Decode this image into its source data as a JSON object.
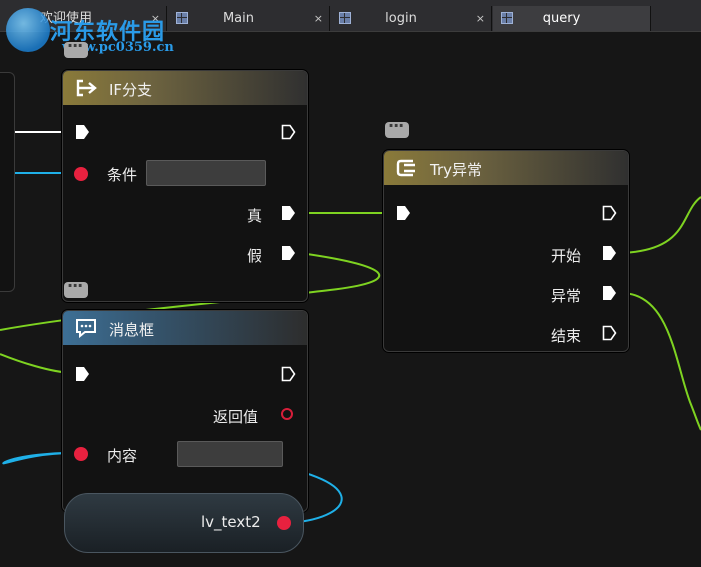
{
  "tabs": [
    {
      "label": "欢迎使用",
      "close": "×",
      "active": false
    },
    {
      "label": "Main",
      "close": "×",
      "active": false
    },
    {
      "label": "login",
      "close": "×",
      "active": false
    },
    {
      "label": "query",
      "close": "",
      "active": true
    }
  ],
  "watermark": {
    "text": "河东软件园",
    "url": "www.pc0359.cn"
  },
  "nodes": {
    "if": {
      "title": "IF分支",
      "condition_label": "条件",
      "true_label": "真",
      "false_label": "假"
    },
    "try": {
      "title": "Try异常",
      "start_label": "开始",
      "exception_label": "异常",
      "end_label": "结束"
    },
    "msgbox": {
      "title": "消息框",
      "return_label": "返回值",
      "content_label": "内容"
    },
    "variable": {
      "name": "lv_text2"
    }
  },
  "icons": {
    "if_head": "branch-icon",
    "try_head": "try-icon",
    "msgbox_head": "message-icon",
    "comment": "comment-bubble-icon"
  },
  "colors": {
    "exec_wire": "#ffffff",
    "data_wire": "#1fb0e8",
    "flow_wire": "#7ed321",
    "pin_data": "#e8213f",
    "gold_header": "#8a7a3a",
    "blue_header": "#3d6f95"
  }
}
